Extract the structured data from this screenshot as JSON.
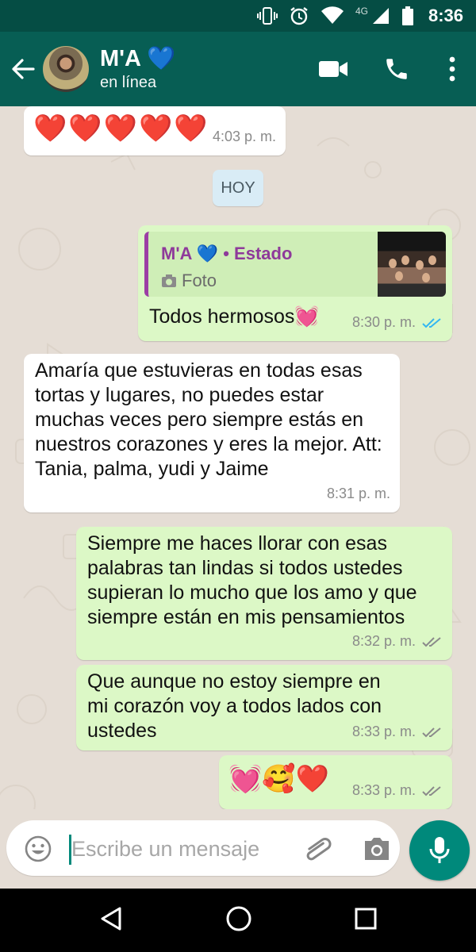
{
  "status_bar": {
    "time": "8:36",
    "network": "4G",
    "icons": [
      "vibrate-icon",
      "alarm-icon",
      "wifi-icon",
      "signal-icon",
      "battery-icon"
    ]
  },
  "header": {
    "contact_name": "M'A 💙",
    "contact_status": "en línea",
    "actions": [
      "video-call-icon",
      "phone-icon",
      "more-icon"
    ]
  },
  "messages": [
    {
      "id": "m1",
      "direction": "incoming",
      "type": "emoji",
      "emoji": "❤️❤️❤️❤️❤️",
      "time": "4:03 p. m."
    },
    {
      "id": "m2",
      "direction": "outgoing",
      "type": "reply",
      "quote_author": "M'A 💙 • Estado",
      "quote_kind": "Foto",
      "text": "Todos hermosos💓",
      "time": "8:30 p. m.",
      "ticks": "read"
    },
    {
      "id": "m3",
      "direction": "incoming",
      "type": "text",
      "text": "Amaría que estuvieras en todas esas tortas y lugares, no puedes estar muchas veces pero siempre estás en nuestros corazones y eres la mejor. Att: Tania, palma, yudi y Jaime",
      "time": "8:31 p. m."
    },
    {
      "id": "m4",
      "direction": "outgoing",
      "type": "text",
      "text": "Siempre me haces llorar con esas palabras tan lindas si todos ustedes supieran lo mucho que los amo y que siempre están en mis pensamientos",
      "time": "8:32 p. m.",
      "ticks": "delivered"
    },
    {
      "id": "m5",
      "direction": "outgoing",
      "type": "text",
      "text": "Que aunque no estoy siempre en mi corazón voy a todos lados con ustedes",
      "time": "8:33 p. m.",
      "ticks": "delivered"
    },
    {
      "id": "m6",
      "direction": "outgoing",
      "type": "emoji",
      "emoji": "💓🥰❤️",
      "time": "8:33 p. m.",
      "ticks": "delivered"
    }
  ],
  "day_divider": "HOY",
  "composer": {
    "placeholder": "Escribe un mensaje"
  },
  "colors": {
    "header": "#075e54",
    "statusbar": "#054d44",
    "outgoing": "#dcf8c6",
    "incoming": "#ffffff",
    "accent": "#00897b",
    "read_tick": "#34b7f1"
  }
}
